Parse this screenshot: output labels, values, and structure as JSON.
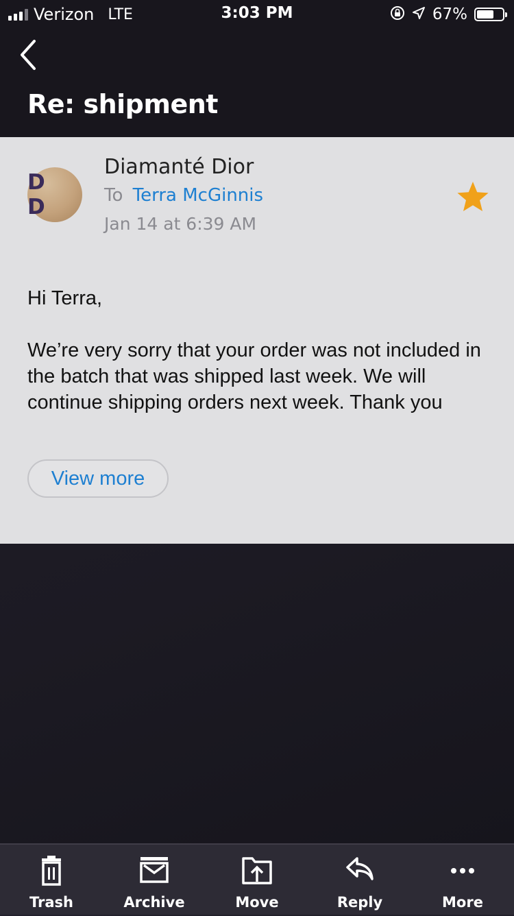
{
  "status_bar": {
    "carrier": "Verizon",
    "network": "LTE",
    "time": "3:03 PM",
    "battery": "67%",
    "battery_level": 0.67,
    "icons": [
      "signal-icon",
      "rotation-lock-icon",
      "location-arrow-icon",
      "battery-icon"
    ]
  },
  "header": {
    "title": "Re: shipment",
    "back_icon": "chevron-left-icon"
  },
  "message": {
    "avatar_initials": "D D",
    "sender": "Diamanté Dior",
    "to_label": "To",
    "recipient": "Terra McGinnis",
    "date": "Jan 14 at 6:39 AM",
    "starred": true,
    "star_color": "#f0a11a",
    "greeting": "Hi Terra,",
    "body": "We’re very sorry that your order was not included in the batch that was shipped last week. We will continue shipping orders next week. Thank you",
    "view_more_label": "View more"
  },
  "toolbar": {
    "trash_label": "Trash",
    "archive_label": "Archive",
    "move_label": "Move",
    "reply_label": "Reply",
    "more_label": "More"
  },
  "colors": {
    "link_blue": "#1d7fd1",
    "card_bg": "#e0e0e2",
    "dark_bg": "#1c1a23",
    "toolbar_bg": "#2d2b35"
  }
}
